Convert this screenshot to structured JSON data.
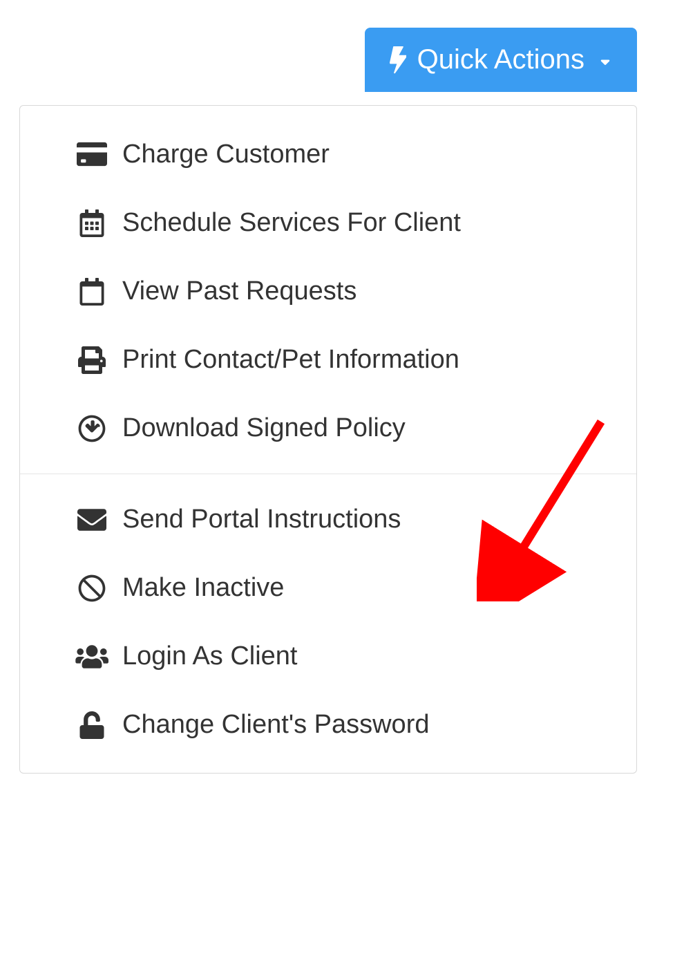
{
  "button": {
    "label": "Quick Actions"
  },
  "menu": {
    "group1": [
      {
        "icon": "credit-card",
        "label": "Charge Customer"
      },
      {
        "icon": "calendar-grid",
        "label": "Schedule Services For Client"
      },
      {
        "icon": "calendar-empty",
        "label": "View Past Requests"
      },
      {
        "icon": "printer",
        "label": "Print Contact/Pet Information"
      },
      {
        "icon": "download-circle",
        "label": "Download Signed Policy"
      }
    ],
    "group2": [
      {
        "icon": "envelope",
        "label": "Send Portal Instructions"
      },
      {
        "icon": "ban",
        "label": "Make Inactive"
      },
      {
        "icon": "users",
        "label": "Login As Client"
      },
      {
        "icon": "unlock",
        "label": "Change Client's Password"
      }
    ]
  }
}
